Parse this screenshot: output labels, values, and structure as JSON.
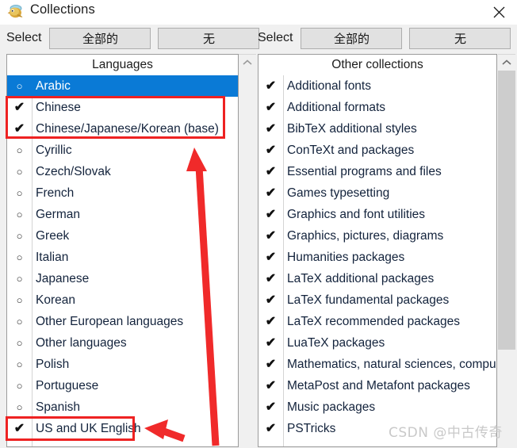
{
  "window": {
    "title": "Collections",
    "icon": "texlive-bird-icon",
    "close_label": "✕"
  },
  "left_panel": {
    "select_label": "Select",
    "buttons": [
      {
        "label": "全部的",
        "name": "select-all-button"
      },
      {
        "label": "无",
        "name": "select-none-button"
      }
    ],
    "header": "Languages",
    "items": [
      {
        "label": "Arabic",
        "checked": false,
        "selected": true
      },
      {
        "label": "Chinese",
        "checked": true,
        "selected": false
      },
      {
        "label": "Chinese/Japanese/Korean (base)",
        "checked": true,
        "selected": false
      },
      {
        "label": "Cyrillic",
        "checked": false,
        "selected": false
      },
      {
        "label": "Czech/Slovak",
        "checked": false,
        "selected": false
      },
      {
        "label": "French",
        "checked": false,
        "selected": false
      },
      {
        "label": "German",
        "checked": false,
        "selected": false
      },
      {
        "label": "Greek",
        "checked": false,
        "selected": false
      },
      {
        "label": "Italian",
        "checked": false,
        "selected": false
      },
      {
        "label": "Japanese",
        "checked": false,
        "selected": false
      },
      {
        "label": "Korean",
        "checked": false,
        "selected": false
      },
      {
        "label": "Other European languages",
        "checked": false,
        "selected": false
      },
      {
        "label": "Other languages",
        "checked": false,
        "selected": false
      },
      {
        "label": "Polish",
        "checked": false,
        "selected": false
      },
      {
        "label": "Portuguese",
        "checked": false,
        "selected": false
      },
      {
        "label": "Spanish",
        "checked": false,
        "selected": false
      },
      {
        "label": "US and UK English",
        "checked": true,
        "selected": false
      }
    ]
  },
  "right_panel": {
    "select_label": "Select",
    "buttons": [
      {
        "label": "全部的",
        "name": "select-all-button"
      },
      {
        "label": "无",
        "name": "select-none-button"
      }
    ],
    "header": "Other collections",
    "items": [
      {
        "label": "Additional fonts",
        "checked": true
      },
      {
        "label": "Additional formats",
        "checked": true
      },
      {
        "label": "BibTeX additional styles",
        "checked": true
      },
      {
        "label": "ConTeXt and packages",
        "checked": true
      },
      {
        "label": "Essential programs and files",
        "checked": true
      },
      {
        "label": "Games typesetting",
        "checked": true
      },
      {
        "label": "Graphics and font utilities",
        "checked": true
      },
      {
        "label": "Graphics, pictures, diagrams",
        "checked": true
      },
      {
        "label": "Humanities packages",
        "checked": true
      },
      {
        "label": "LaTeX additional packages",
        "checked": true
      },
      {
        "label": "LaTeX fundamental packages",
        "checked": true
      },
      {
        "label": "LaTeX recommended packages",
        "checked": true
      },
      {
        "label": "LuaTeX packages",
        "checked": true
      },
      {
        "label": "Mathematics, natural sciences, compu",
        "checked": true
      },
      {
        "label": "MetaPost and Metafont packages",
        "checked": true
      },
      {
        "label": "Music packages",
        "checked": true
      },
      {
        "label": "PSTricks",
        "checked": true
      }
    ]
  },
  "glyphs": {
    "checked": "✔",
    "unchecked": "○",
    "scroll_up": "⌃"
  },
  "annotations": {
    "box_chinese": "highlight-chinese-rows",
    "box_english": "highlight-us-uk-english-row",
    "arrow_long": "arrow-pointing-to-chinese-rows",
    "arrow_short": "arrow-pointing-to-english-row",
    "color": "#ee2222"
  },
  "watermark": {
    "text": "CSDN @中古传奇"
  },
  "colors": {
    "selection_blue": "#0a7ad6",
    "annotation_red": "#ee2222",
    "button_face": "#e1e1e1",
    "window_bg": "#f0f0f0"
  }
}
